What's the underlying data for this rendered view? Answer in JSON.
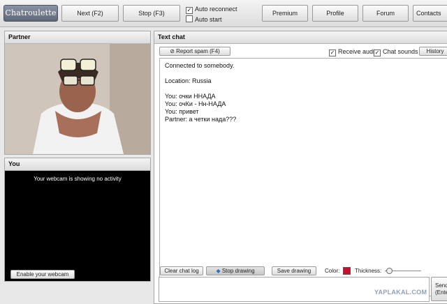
{
  "topbar": {
    "logo": "Chatroulette",
    "next_label": "Next (F2)",
    "stop_label": "Stop (F3)",
    "auto_reconnect": {
      "label": "Auto reconnect",
      "checked": true
    },
    "auto_start": {
      "label": "Auto start",
      "checked": false
    },
    "nav": [
      "Premium",
      "Profile",
      "Forum",
      "Contacts"
    ]
  },
  "partner_panel": {
    "title": "Partner"
  },
  "you_panel": {
    "title": "You",
    "status": "Your webcam is showing no activity",
    "enable_label": "Enable your webcam"
  },
  "chat": {
    "title": "Text chat",
    "report_label": "Report spam (F4)",
    "receive_audio": {
      "label": "Receive audio",
      "checked": true
    },
    "chat_sounds": {
      "label": "Chat sounds",
      "checked": true
    },
    "history_label": "History",
    "messages": [
      "Connected to somebody.",
      "Location: Russia",
      "You: очки ННАДА",
      "You: очКи - Нн-НАДА",
      "You: привет",
      "Partner: а четки нада???"
    ],
    "clear_label": "Clear chat log",
    "stop_drawing_label": "Stop drawing",
    "save_drawing_label": "Save drawing",
    "color_label": "Color:",
    "color_value": "#c8102e",
    "thickness_label": "Thickness:",
    "thickness_value": 0.12,
    "send_label_1": "Send",
    "send_label_2": "(Enter)",
    "input_value": ""
  },
  "watermark": "YAPLAKAL.COM"
}
